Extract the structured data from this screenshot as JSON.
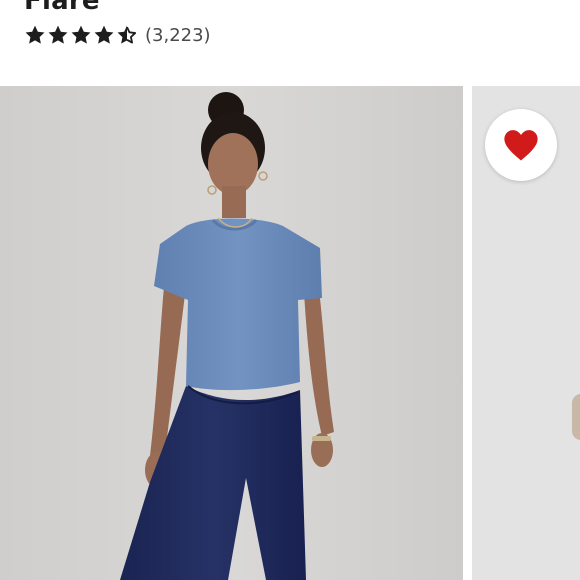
{
  "product": {
    "title_partial": "Flare",
    "rating": 4.5,
    "review_count": "(3,223)"
  },
  "gallery": {
    "favorite_icon": "heart-icon",
    "favorite_color": "#d11a1a"
  },
  "colors": {
    "star": "#1d1d1d",
    "top": "#6d8ebd",
    "leggings": "#1f2a5c",
    "background": "#d4d3d1"
  }
}
